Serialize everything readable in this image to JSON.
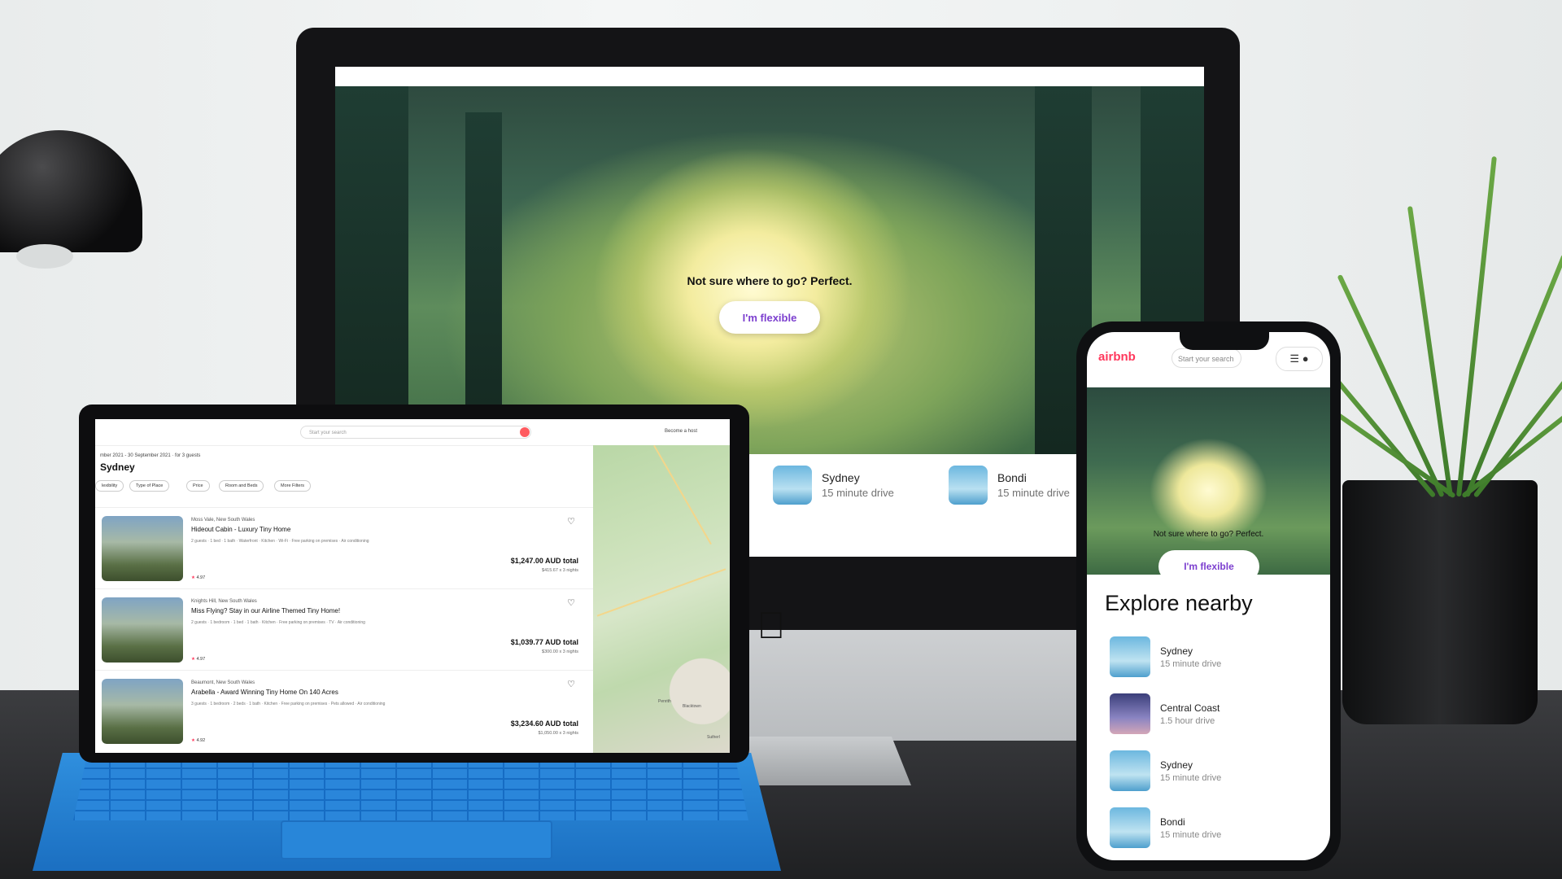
{
  "imac": {
    "hero_text": "Not sure where to go? Perfect.",
    "flex_button": "I'm flexible",
    "nearby": [
      {
        "name": "Sydney",
        "distance": "15 minute drive"
      },
      {
        "name": "Bondi",
        "distance": "15 minute drive"
      }
    ]
  },
  "tablet": {
    "search_placeholder": "Start your search",
    "become_host": "Become a host",
    "dates": "mber 2021 - 30 September 2021 · for 3 guests",
    "city": "Sydney",
    "filters": [
      "lexibility",
      "Type of Place",
      "Price",
      "Room and Beds",
      "More Filters"
    ],
    "listings": [
      {
        "location": "Moss Vale, New South Wales",
        "title": "Hideout Cabin - Luxury Tiny Home",
        "details": "2 guests · 1 bed · 1 bath · Waterfront · Kitchen · Wi-Fi · Free parking on premises · Air conditioning",
        "rating": "4.97",
        "total": "$1,247.00 AUD total",
        "nightly": "$415.67 x 3 nights"
      },
      {
        "location": "Knights Hill, New South Wales",
        "title": "Miss Flying? Stay in our Airline Themed Tiny Home!",
        "details": "2 guests · 1 bedroom · 1 bed · 1 bath · Kitchen · Free parking on premises · TV · Air conditioning",
        "rating": "4.97",
        "total": "$1,039.77 AUD total",
        "nightly": "$300.00 x 3 nights"
      },
      {
        "location": "Beaumont, New South Wales",
        "title": "Arabella - Award Winning Tiny Home On 140 Acres",
        "details": "3 guests · 1 bedroom · 2 beds · 1 bath · Kitchen · Free parking on premises · Pets allowed · Air conditioning",
        "rating": "4.92",
        "total": "$3,234.60 AUD total",
        "nightly": "$1,050.00 x 3 nights"
      }
    ],
    "map_labels": [
      "Penrith",
      "Blacktown",
      "Sutherl"
    ]
  },
  "phone": {
    "logo": "airbnb",
    "search_placeholder": "Start your search",
    "hero_text": "Not sure where to go? Perfect.",
    "flex_button": "I'm flexible",
    "explore_title": "Explore nearby",
    "nearby": [
      {
        "name": "Sydney",
        "distance": "15 minute drive"
      },
      {
        "name": "Central Coast",
        "distance": "1.5 hour drive"
      },
      {
        "name": "Sydney",
        "distance": "15 minute drive"
      },
      {
        "name": "Bondi",
        "distance": "15 minute drive"
      }
    ]
  },
  "colors": {
    "brand": "#ff385c",
    "flex_text": "#7c3fcf"
  },
  "icons": [
    "apple-logo-icon",
    "heart-icon",
    "star-icon",
    "search-icon",
    "menu-icon",
    "user-icon",
    "airbnb-logo-icon"
  ]
}
